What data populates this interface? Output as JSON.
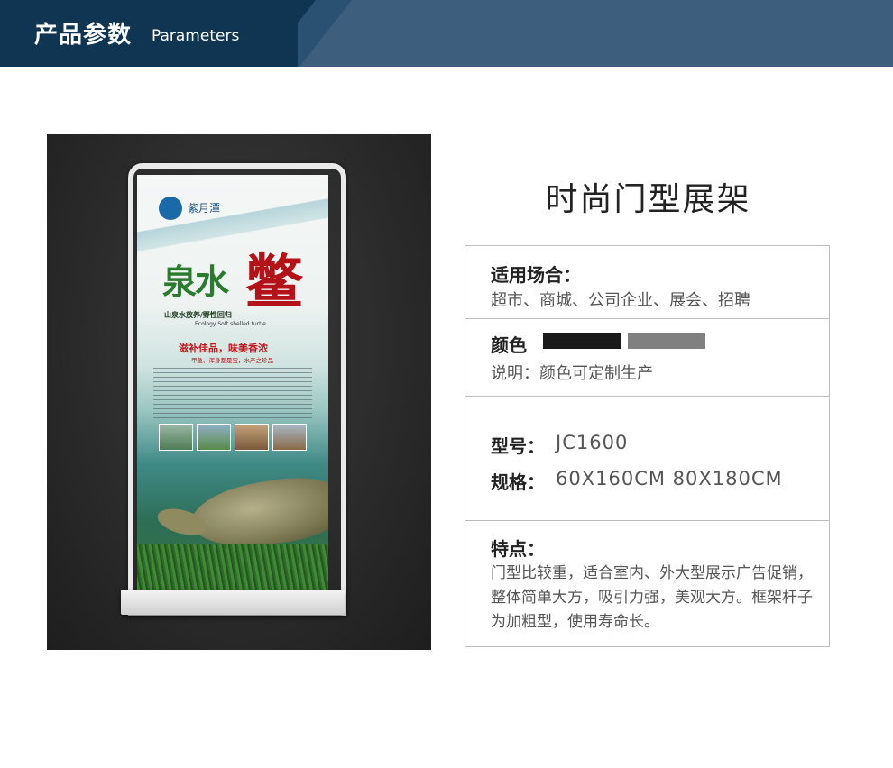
{
  "header": {
    "title": "产品参数",
    "subtitle": "Parameters"
  },
  "poster": {
    "logo_text": "紫月潭",
    "title_main": "泉水",
    "title_big": "鳖",
    "tagline": "山泉水放养/野性回归",
    "tagline_en": "Ecology Soft shelled turtle",
    "slogan": "滋补佳品，味美香浓",
    "slogan_sub": "甲鱼、浑身都是宝，水产之珍品"
  },
  "product": {
    "title": "时尚门型展架",
    "occasion_label": "适用场合：",
    "occasion_value": "超市、商城、公司企业、展会、招聘",
    "color_label": "颜色",
    "color_swatches": [
      "#1a1a1a",
      "#808080"
    ],
    "color_note": "说明：颜色可定制生产",
    "model_label": "型号：",
    "model_value": "JC1600",
    "spec_label": "规格：",
    "spec_value": "60X160CM 80X180CM",
    "features_label": "特点：",
    "features_value": "门型比较重，适合室内、外大型展示广告促销，整体简单大方，吸引力强，美观大方。框架杆子为加粗型，使用寿命长。"
  }
}
